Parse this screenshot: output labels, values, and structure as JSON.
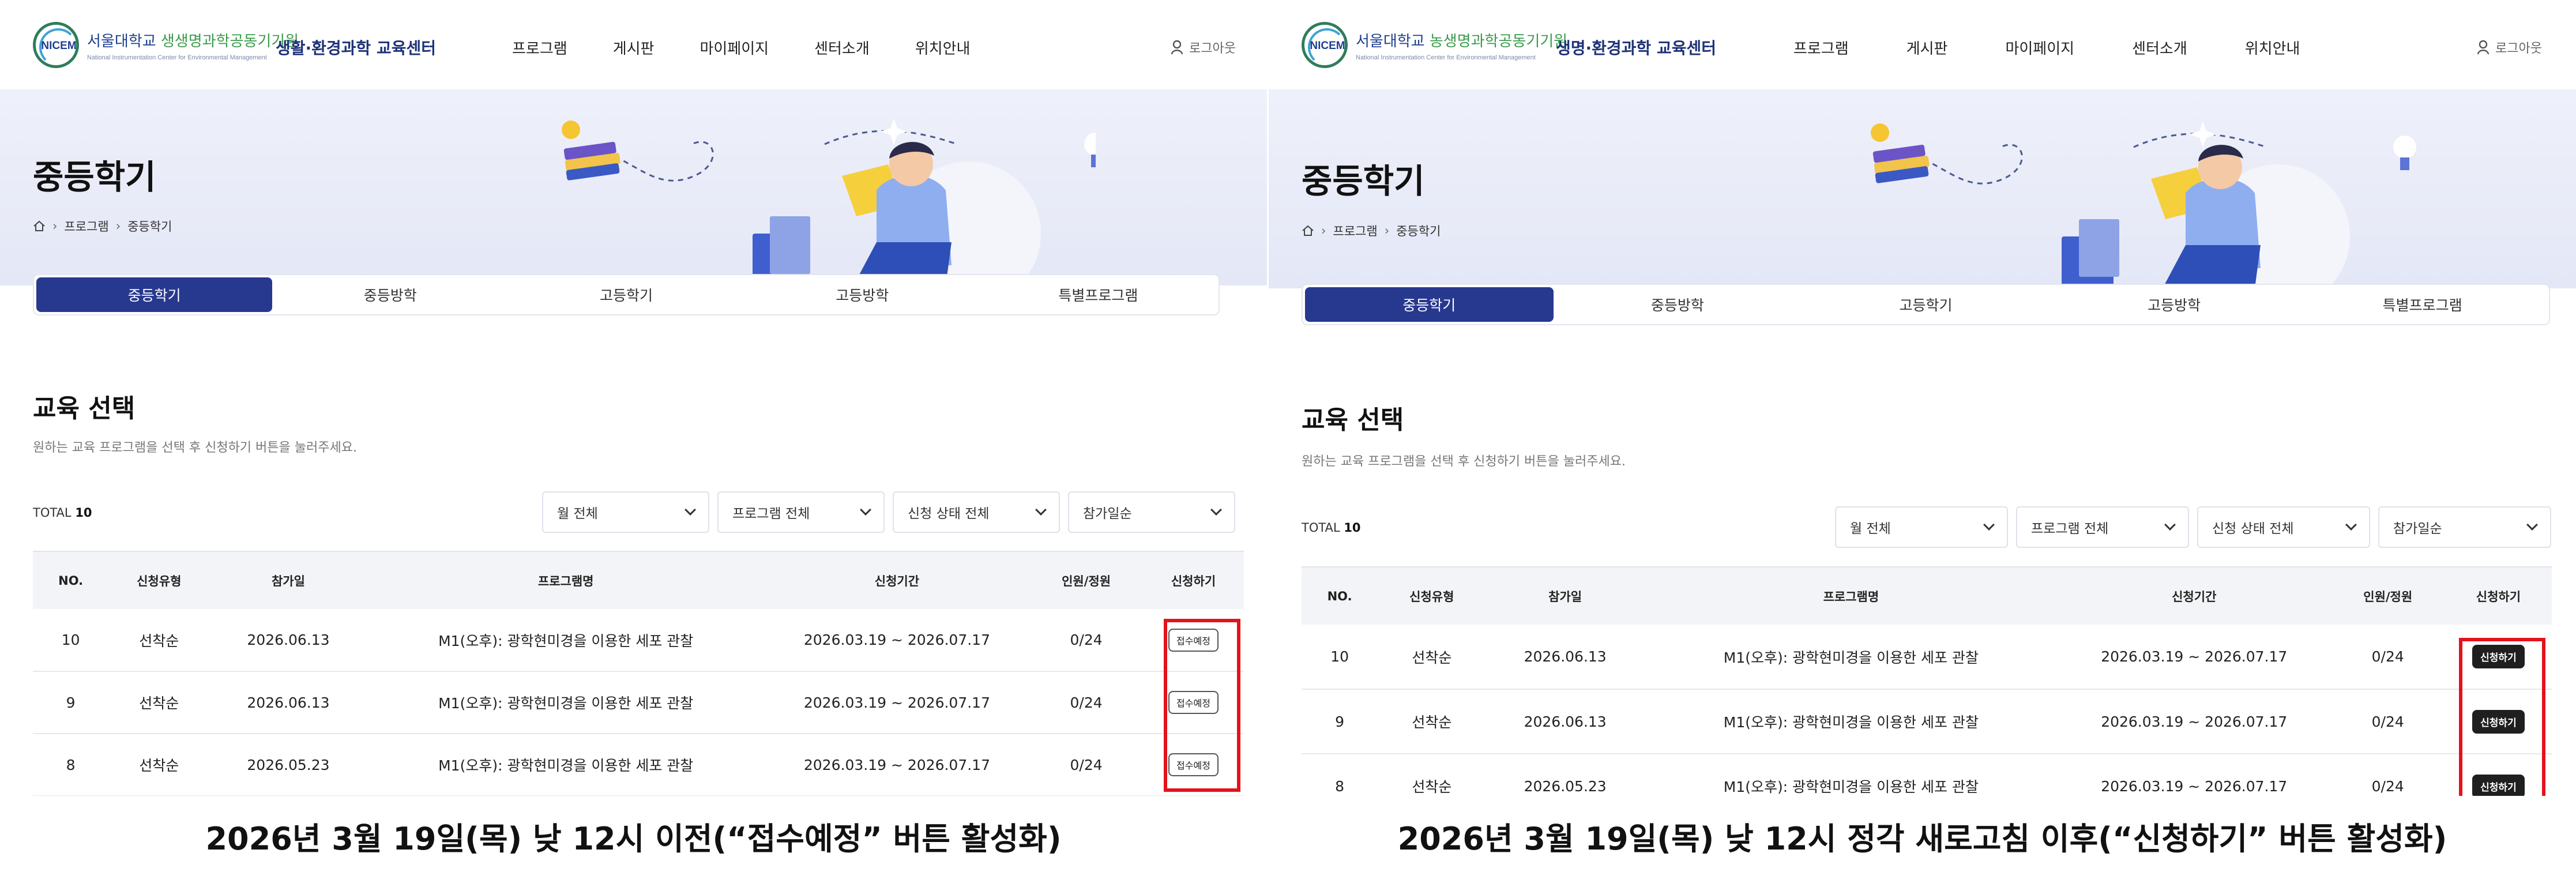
{
  "header": {
    "logo_word": "NICEM",
    "logo_line1_a": "서울대학교",
    "logo_line1_b_left": "생생명과학공동기기원",
    "logo_line1_b_right": "농생명과학공동기기원",
    "logo_line2": "National Instrumentation Center for Environmental Management",
    "center_name_left": "생활·환경과학 교육센터",
    "center_name_right": "생명·환경과학 교육센터",
    "nav": [
      "프로그램",
      "게시판",
      "마이페이지",
      "센터소개",
      "위치안내"
    ],
    "logout": "로그아웃"
  },
  "hero": {
    "title": "중등학기",
    "breadcrumb": [
      "프로그램",
      "중등학기"
    ]
  },
  "tabs": [
    "중등학기",
    "중등방학",
    "고등학기",
    "고등방학",
    "특별프로그램"
  ],
  "section": {
    "title": "교육 선택",
    "desc": "원하는 교육 프로그램을 선택 후 신청하기 버튼을 눌러주세요.",
    "total_label": "TOTAL",
    "total_value": "10"
  },
  "filters": [
    "월 전체",
    "프로그램 전체",
    "신청 상태 전체",
    "참가일순"
  ],
  "table": {
    "headers": [
      "NO.",
      "신청유형",
      "참가일",
      "프로그램명",
      "신청기간",
      "인원/정원",
      "신청하기"
    ],
    "rows": [
      {
        "no": "10",
        "type": "선착순",
        "date": "2026.06.13",
        "program": "M1(오후): 광학현미경을 이용한 세포 관찰",
        "period": "2026.03.19 ~ 2026.07.17",
        "count": "0/24"
      },
      {
        "no": "9",
        "type": "선착순",
        "date": "2026.06.13",
        "program": "M1(오후): 광학현미경을 이용한 세포 관찰",
        "period": "2026.03.19 ~ 2026.07.17",
        "count": "0/24"
      },
      {
        "no": "8",
        "type": "선착순",
        "date": "2026.05.23",
        "program": "M1(오후): 광학현미경을 이용한 세포 관찰",
        "period": "2026.03.19 ~ 2026.07.17",
        "count": "0/24"
      }
    ],
    "btn_before": "접수예정",
    "btn_after": "신청하기"
  },
  "captions": {
    "left": "2026년 3월 19일(목) 낮 12시 이전(“접수예정” 버튼 활성화)",
    "right": "2026년 3월 19일(목) 낮 12시 정각 새로고침 이후(“신청하기” 버튼 활성화)"
  },
  "colors": {
    "accent": "#27388f",
    "hero_bg": "#e8eaf7",
    "highlight": "#e3121b"
  }
}
